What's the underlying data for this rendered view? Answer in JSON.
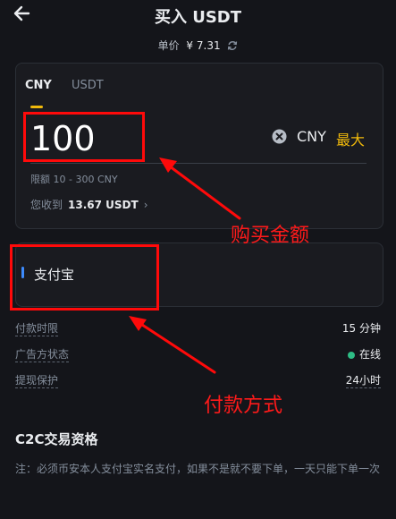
{
  "header": {
    "title": "买入 USDT",
    "unit_price_label": "单价",
    "unit_price_value": "¥ 7.31"
  },
  "amount_card": {
    "tabs": [
      {
        "label": "CNY",
        "active": true
      },
      {
        "label": "USDT",
        "active": false
      }
    ],
    "input_value": "100",
    "currency_suffix": "CNY",
    "max_label": "最大",
    "limit_text": "限额  10 - 300 CNY",
    "receive_label": "您收到",
    "receive_amount": "13.67 USDT"
  },
  "payment": {
    "method_label": "支付宝"
  },
  "info": [
    {
      "label": "付款时限",
      "value": "15 分钟"
    },
    {
      "label": "广告方状态",
      "value": "在线"
    },
    {
      "label": "提现保护",
      "value": "24小时"
    }
  ],
  "c2c": {
    "title": "C2C交易资格",
    "note": "注：必须币安本人支付宝实名支付，如果不是就不要下单，一天只能下单一次"
  },
  "annotations": {
    "amount_label": "购买金额",
    "payment_label": "付款方式"
  },
  "colors": {
    "background": "#14151a",
    "card": "#1a1b20",
    "accent": "#f0b90b",
    "online": "#2ebd85",
    "payment_bar": "#3d8bfd",
    "annotation": "#ff0a0a"
  }
}
